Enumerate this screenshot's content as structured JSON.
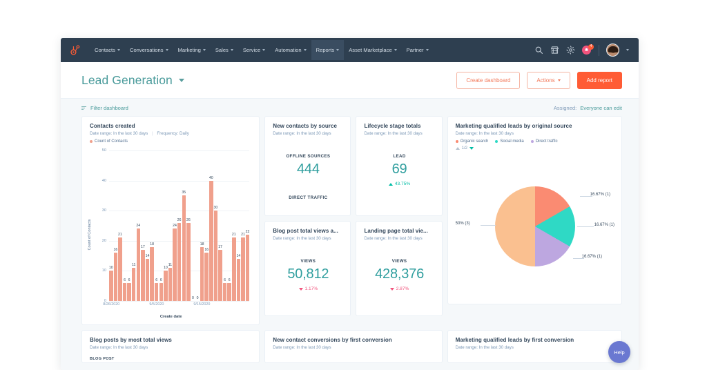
{
  "nav": {
    "logo_icon": "hubspot-sprocket-icon",
    "items": [
      {
        "label": "Contacts",
        "active": false
      },
      {
        "label": "Conversations",
        "active": false
      },
      {
        "label": "Marketing",
        "active": false
      },
      {
        "label": "Sales",
        "active": false
      },
      {
        "label": "Service",
        "active": false
      },
      {
        "label": "Automation",
        "active": false
      },
      {
        "label": "Reports",
        "active": true
      },
      {
        "label": "Asset Marketplace",
        "active": false
      },
      {
        "label": "Partner",
        "active": false
      }
    ],
    "right_icons": [
      "search-icon",
      "marketplace-icon",
      "settings-gear-icon",
      "notifications-icon"
    ],
    "notification_count": "4"
  },
  "header": {
    "title": "Lead Generation",
    "create_dashboard": "Create dashboard",
    "actions": "Actions",
    "add_report": "Add report"
  },
  "filter_bar": {
    "filter_label": "Filter dashboard",
    "assigned_label": "Assigned:",
    "assigned_value": "Everyone can edit"
  },
  "colors": {
    "nav_bg": "#2e3f50",
    "accent_orange": "#ff5c35",
    "teal": "#2f9e9e",
    "bar": "#f0a08c",
    "positive": "#00bda5",
    "negative": "#f2547d",
    "pie_peach": "#fac090",
    "pie_salmon": "#fa8b72",
    "pie_teal": "#2fd9c5",
    "pie_purple": "#bda7e0"
  },
  "cards": {
    "contacts_created": {
      "title": "Contacts created",
      "date_range": "Date range: In the last 30 days",
      "frequency": "Frequency: Daily",
      "legend": "Count of Contacts"
    },
    "new_contacts_by_source": {
      "title": "New contacts by source",
      "date_range": "Date range: In the last 30 days",
      "label": "OFFLINE SOURCES",
      "value": "444",
      "label2": "DIRECT TRAFFIC"
    },
    "lifecycle_stage_totals": {
      "title": "Lifecycle stage totals",
      "date_range": "Date range: In the last 30 days",
      "label": "LEAD",
      "value": "69",
      "delta": "43.75%",
      "delta_dir": "up"
    },
    "blog_post_views": {
      "title": "Blog post total views a...",
      "date_range": "Date range: In the last 30 days",
      "label": "VIEWS",
      "value": "50,812",
      "delta": "1.17%",
      "delta_dir": "down"
    },
    "landing_page_views": {
      "title": "Landing page total vie...",
      "date_range": "Date range: In the last 30 days",
      "label": "VIEWS",
      "value": "428,376",
      "delta": "2.87%",
      "delta_dir": "down"
    },
    "mql_by_original_source": {
      "title": "Marketing qualified leads by original source",
      "date_range": "Date range: In the last 30 days",
      "pager": "1/2"
    },
    "blog_posts_most_views": {
      "title": "Blog posts by most total views",
      "date_range": "Date range: In the last 30 days",
      "column": "BLOG POST"
    },
    "new_contact_conversions": {
      "title": "New contact conversions by first conversion",
      "date_range": "Date range: In the last 30 days"
    },
    "mql_by_first_conversion": {
      "title": "Marketing qualified leads by first conversion",
      "date_range": "Date range: In the last 30 days"
    }
  },
  "help_button": "Help",
  "chart_data": [
    {
      "type": "bar",
      "title": "Contacts created",
      "xlabel": "Create date",
      "ylabel": "Count of Contacts",
      "ylim": [
        0,
        50
      ],
      "yticks": [
        0,
        10,
        20,
        30,
        40,
        50
      ],
      "legend": [
        "Count of Contacts"
      ],
      "xtick_labels": [
        "8/26/2020",
        "9/5/2020",
        "9/15/2020"
      ],
      "xtick_positions": [
        0,
        10,
        20
      ],
      "grid": true,
      "values": [
        10,
        16,
        21,
        6,
        6,
        11,
        24,
        17,
        14,
        18,
        6,
        6,
        10,
        11,
        24,
        26,
        35,
        26,
        0,
        0,
        18,
        16,
        40,
        30,
        17,
        6,
        6,
        21,
        14,
        21,
        22
      ],
      "series": [
        {
          "name": "Count of Contacts",
          "values": [
            10,
            16,
            21,
            6,
            6,
            11,
            24,
            17,
            14,
            18,
            6,
            6,
            10,
            11,
            24,
            26,
            35,
            26,
            0,
            0,
            18,
            16,
            40,
            30,
            17,
            6,
            6,
            21,
            14,
            21,
            22
          ]
        }
      ]
    },
    {
      "type": "pie",
      "title": "Marketing qualified leads by original source",
      "legend_position": "top",
      "labels": [
        "Organic search",
        "Social media",
        "Direct traffic"
      ],
      "legend_colors": [
        "#fa8b72",
        "#2fd9c5",
        "#bda7e0"
      ],
      "slices": [
        {
          "label": "50% (3)",
          "percent": 50,
          "count": 3,
          "color": "#fac090"
        },
        {
          "label": "16.67% (1)",
          "percent": 16.67,
          "count": 1,
          "color": "#fa8b72"
        },
        {
          "label": "16.67% (1)",
          "percent": 16.67,
          "count": 1,
          "color": "#2fd9c5"
        },
        {
          "label": "16.67% (1)",
          "percent": 16.67,
          "count": 1,
          "color": "#bda7e0"
        }
      ]
    }
  ]
}
